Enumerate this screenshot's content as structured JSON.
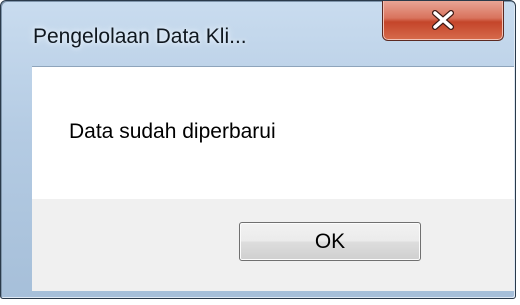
{
  "window": {
    "title": "Pengelolaan Data Kli..."
  },
  "titlebar": {
    "close_icon": "close-icon"
  },
  "dialog": {
    "message": "Data sudah diperbarui",
    "ok_label": "OK"
  },
  "colors": {
    "frame": "#b4cbe3",
    "close_button": "#c4452a",
    "content_background": "#ffffff",
    "button_area": "#f0f0f0"
  }
}
